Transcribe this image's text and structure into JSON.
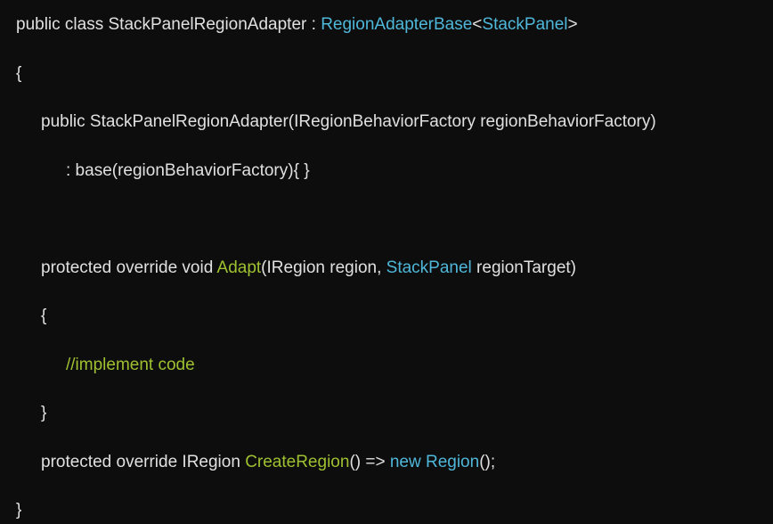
{
  "code": {
    "line1": {
      "part1": "public class StackPanelRegionAdapter : ",
      "part2": "RegionAdapterBase",
      "part3": "<",
      "part4": "StackPanel",
      "part5": ">"
    },
    "line2": "{",
    "line3": "public StackPanelRegionAdapter(IRegionBehaviorFactory regionBehaviorFactory)",
    "line4": ": base(regionBehaviorFactory){ }",
    "line5": {
      "part1": "protected override void ",
      "part2": "Adapt",
      "part3": "(IRegion region, ",
      "part4": "StackPanel",
      "part5": " regionTarget)"
    },
    "line6": "{",
    "line7": "//implement code",
    "line8": "}",
    "line9": {
      "part1": "protected override IRegion ",
      "part2": "CreateRegion",
      "part3": "() => ",
      "part4": "new",
      "part5": " ",
      "part6": "Region",
      "part7": "();"
    },
    "line10": "}"
  }
}
